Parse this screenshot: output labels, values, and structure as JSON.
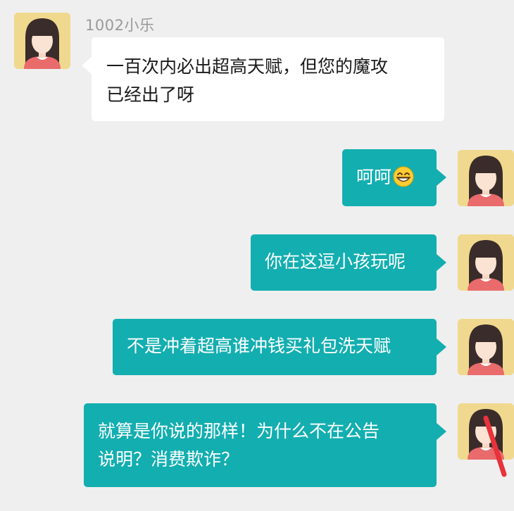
{
  "chat": {
    "sender_name": "1002小乐",
    "messages": [
      {
        "direction": "incoming",
        "lines": [
          "一百次内必出超高天赋，但您的魔攻",
          "已经出了呀"
        ]
      },
      {
        "direction": "outgoing",
        "lines": [
          "呵呵"
        ],
        "emoji": "grinning-face-emoji"
      },
      {
        "direction": "outgoing",
        "lines": [
          "你在这逗小孩玩呢"
        ]
      },
      {
        "direction": "outgoing",
        "lines": [
          "不是冲着超高谁冲钱买礼包洗天赋"
        ]
      },
      {
        "direction": "outgoing",
        "lines": [
          "就算是你说的那样！为什么不在公告",
          "说明？消费欺诈？"
        ]
      }
    ]
  },
  "colors": {
    "background": "#efefef",
    "incoming_bubble": "#ffffff",
    "outgoing_bubble": "#13aeb0",
    "avatar_background": "#f0d98e",
    "sender_name": "#9a9a9a",
    "annotation_mark": "#e8323c"
  }
}
